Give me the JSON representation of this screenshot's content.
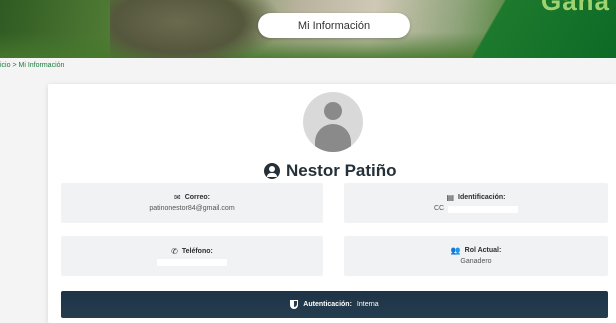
{
  "header": {
    "page_button_label": "Mi Información",
    "brand_fragment": "Gana"
  },
  "breadcrumb": {
    "home": "icio",
    "separator": ">",
    "current": "Mi Información"
  },
  "profile": {
    "name": "Nestor Patiño"
  },
  "fields": {
    "email": {
      "label": "Correo:",
      "value": "patinonestor84@gmail.com"
    },
    "identification": {
      "label": "Identificación:",
      "prefix": "CC"
    },
    "phone": {
      "label": "Teléfono:"
    },
    "role": {
      "label": "Rol Actual:",
      "value": "Ganadero"
    }
  },
  "auth": {
    "label": "Autenticación:",
    "value": "Interna"
  },
  "colors": {
    "primary_dark": "#243d4f",
    "accent_green": "#1a7b3a"
  }
}
